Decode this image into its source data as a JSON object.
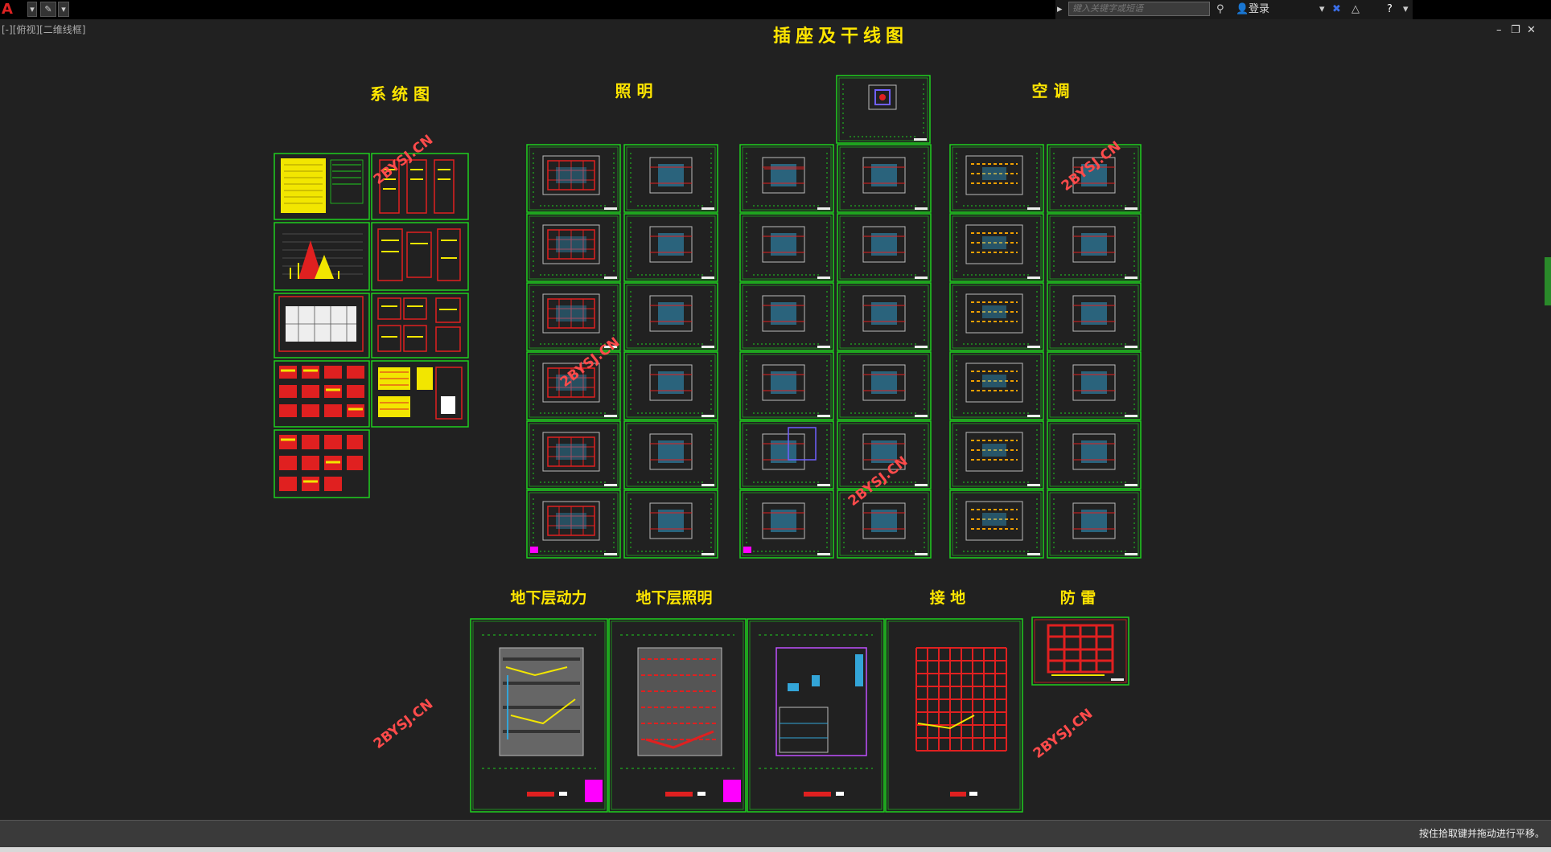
{
  "app": {
    "logo": "A",
    "search_placeholder": "键入关键字或短语",
    "login": "登录"
  },
  "viewport": {
    "label": "[-][俯视][二维线框]"
  },
  "status": {
    "message": "按住拾取键并拖动进行平移。"
  },
  "drawing": {
    "title": "插座及干线图",
    "sections": {
      "system": "系 统 图",
      "lighting": "照  明",
      "aircon": "空  调",
      "basement_power": "地下层动力",
      "basement_lighting": "地下层照明",
      "grounding": "接  地",
      "lightning": "防  雷"
    },
    "watermark": "2BYSJ.CN"
  },
  "colors": {
    "frame": "#1fd01f",
    "label": "#ffe600",
    "watermark": "#ff4b4b",
    "red": "#e02020",
    "yellow": "#f2e600",
    "cyan": "#33a5d8",
    "magenta": "#ff00ff"
  }
}
